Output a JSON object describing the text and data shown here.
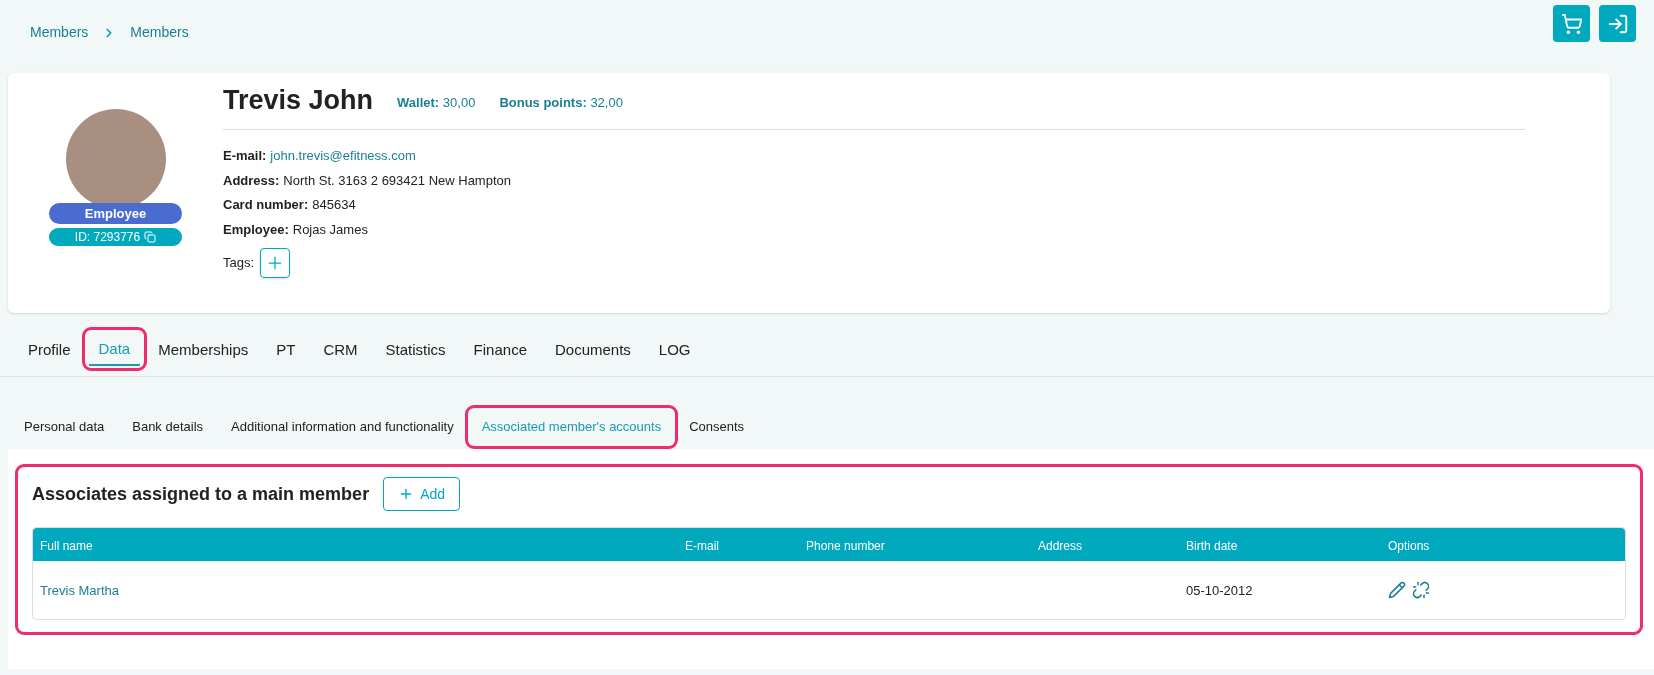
{
  "breadcrumbs": [
    "Members",
    "Members"
  ],
  "top_actions": [
    {
      "kind": "cart"
    },
    {
      "kind": "login"
    }
  ],
  "member": {
    "name": "Trevis John",
    "wallet_label": "Wallet:",
    "wallet": "30,00",
    "bonus_label": "Bonus points:",
    "bonus": "32,00",
    "role": "Employee",
    "id": "ID: 7293776",
    "fields": [
      {
        "label": "E-mail:",
        "value": "john.trevis@efitness.com",
        "kind": "link"
      },
      {
        "label": "Address:",
        "value": "North St. 3163 2 693421 New Hampton",
        "kind": "text"
      },
      {
        "label": "Card number:",
        "value": "845634",
        "kind": "text"
      },
      {
        "label": "Employee:",
        "value": "Rojas James",
        "kind": "text"
      }
    ],
    "tags_label": "Tags:"
  },
  "tabs": [
    {
      "label": "Profile",
      "selected": false,
      "highlighted": false
    },
    {
      "label": "Data",
      "selected": true,
      "highlighted": true
    },
    {
      "label": "Memberships",
      "selected": false,
      "highlighted": false
    },
    {
      "label": "PT",
      "selected": false,
      "highlighted": false
    },
    {
      "label": "CRM",
      "selected": false,
      "highlighted": false
    },
    {
      "label": "Statistics",
      "selected": false,
      "highlighted": false
    },
    {
      "label": "Finance",
      "selected": false,
      "highlighted": false
    },
    {
      "label": "Documents",
      "selected": false,
      "highlighted": false
    },
    {
      "label": "LOG",
      "selected": false,
      "highlighted": false
    }
  ],
  "subtabs": [
    {
      "label": "Personal data",
      "selected": false,
      "highlighted": false
    },
    {
      "label": "Bank details",
      "selected": false,
      "highlighted": false
    },
    {
      "label": "Additional information and functionality",
      "selected": false,
      "highlighted": false
    },
    {
      "label": "Associated member's accounts",
      "selected": true,
      "highlighted": true
    },
    {
      "label": "Consents",
      "selected": false,
      "highlighted": false
    }
  ],
  "section": {
    "title": "Associates assigned to a main member",
    "highlighted": true,
    "add_button": "Add",
    "table": {
      "columns": [
        "Full name",
        "E-mail",
        "Phone number",
        "Address",
        "Birth date",
        "Options"
      ],
      "rows": [
        {
          "full_name": "Trevis Martha",
          "email": "",
          "phone": "",
          "address": "",
          "birth_date": "05-10-2012"
        }
      ]
    }
  }
}
